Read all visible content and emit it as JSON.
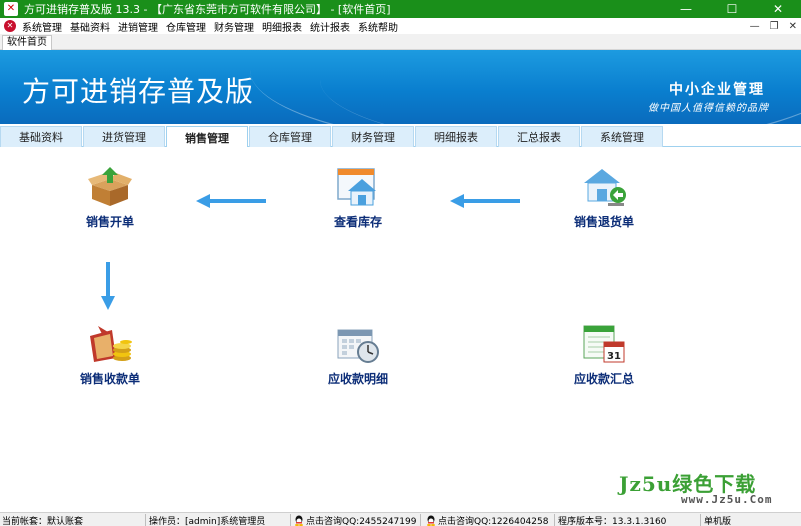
{
  "window": {
    "title": "方可进销存普及版 13.3 - 【广东省东莞市方可软件有限公司】 - [软件首页]",
    "minimize_glyph": "—",
    "maximize_glyph": "☐",
    "close_glyph": "✕"
  },
  "menubar": {
    "logo_glyph": "✕",
    "items": [
      "系统管理",
      "基础资料",
      "进销管理",
      "仓库管理",
      "财务管理",
      "明细报表",
      "统计报表",
      "系统帮助"
    ],
    "mdi_minimize": "—",
    "mdi_maximize": "❐",
    "mdi_close": "✕"
  },
  "doc_tabs": [
    "软件首页"
  ],
  "banner": {
    "brand": "方可进销存普及版",
    "slogan_main": "中小企业管理",
    "slogan_sub": "做中国人值得信赖的品牌"
  },
  "module_tabs": {
    "items": [
      "基础资料",
      "进货管理",
      "销售管理",
      "仓库管理",
      "财务管理",
      "明细报表",
      "汇总报表",
      "系统管理"
    ],
    "active_index": 2
  },
  "modules": {
    "sales_order": {
      "label": "销售开单",
      "icon": "box-upload-icon"
    },
    "view_stock": {
      "label": "查看库存",
      "icon": "warehouse-window-icon"
    },
    "sales_return": {
      "label": "销售退货单",
      "icon": "warehouse-return-icon"
    },
    "sales_receipt": {
      "label": "销售收款单",
      "icon": "coins-icon"
    },
    "receivable_detail": {
      "label": "应收款明细",
      "icon": "calendar-clock-icon"
    },
    "receivable_summary": {
      "label": "应收款汇总",
      "icon": "calendar-31-icon"
    },
    "calendar_day": "31"
  },
  "watermark": {
    "main": "Jz5u绿色下载",
    "sub": "www.Jz5u.Com"
  },
  "statusbar": {
    "account": "当前帐套：默认账套",
    "operator": "操作员：[admin]系统管理员",
    "qq1": "点击咨询QQ:2455247199",
    "qq2": "点击咨询QQ:1226404258",
    "version": "程序版本号：13.3.1.3160",
    "edition": "单机版"
  },
  "colors": {
    "titlebar": "#1a8f1a",
    "banner": "#0a7fcf",
    "module_label": "#0d2e78",
    "arrow": "#3a9de6",
    "watermark": "#3ba035"
  }
}
